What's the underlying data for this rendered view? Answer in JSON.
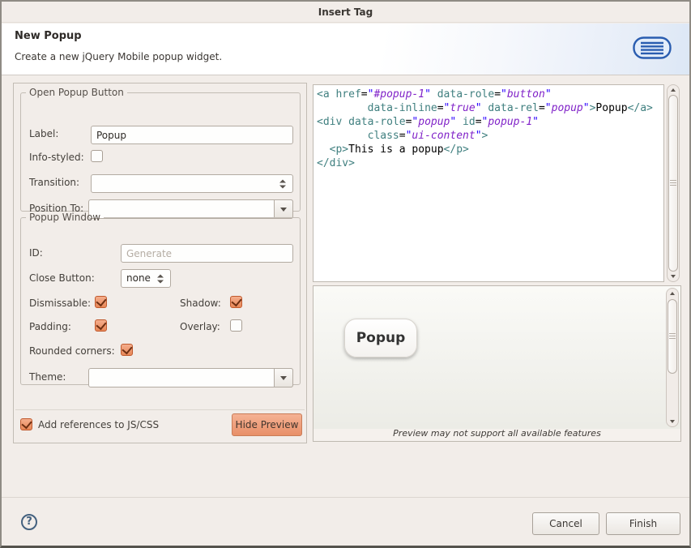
{
  "window": {
    "title": "Insert Tag"
  },
  "header": {
    "title": "New Popup",
    "description": "Create a new jQuery Mobile popup widget."
  },
  "form": {
    "open_popup_button_group": {
      "legend": "Open Popup Button",
      "label_field": {
        "label": "Label:",
        "value": "Popup"
      },
      "info_styled": {
        "label": "Info-styled:",
        "checked": false
      },
      "transition": {
        "label": "Transition:",
        "value": ""
      },
      "position_to": {
        "label": "Position To:",
        "value": ""
      }
    },
    "popup_window_group": {
      "legend": "Popup Window",
      "id_field": {
        "label": "ID:",
        "value": "",
        "placeholder": "Generate"
      },
      "close_button": {
        "label": "Close Button:",
        "value": "none"
      },
      "dismissable": {
        "label": "Dismissable:",
        "checked": true
      },
      "shadow": {
        "label": "Shadow:",
        "checked": true
      },
      "padding": {
        "label": "Padding:",
        "checked": true
      },
      "overlay": {
        "label": "Overlay:",
        "checked": false
      },
      "rounded_corners": {
        "label": "Rounded corners:",
        "checked": true
      },
      "theme": {
        "label": "Theme:",
        "value": ""
      }
    },
    "add_references": {
      "label": "Add references to JS/CSS",
      "checked": true
    },
    "hide_preview_button_label": "Hide Preview"
  },
  "code": {
    "lines": [
      [
        [
          "tag",
          "<a"
        ],
        [
          "pln",
          " "
        ],
        [
          "attr",
          "href"
        ],
        [
          "pln",
          "="
        ],
        [
          "q",
          "\""
        ],
        [
          "val",
          "#popup-1"
        ],
        [
          "q",
          "\""
        ],
        [
          "pln",
          " "
        ],
        [
          "attr",
          "data-role"
        ],
        [
          "pln",
          "="
        ],
        [
          "q",
          "\""
        ],
        [
          "val",
          "button"
        ],
        [
          "q",
          "\""
        ]
      ],
      [
        [
          "pln",
          "        "
        ],
        [
          "attr",
          "data-inline"
        ],
        [
          "pln",
          "="
        ],
        [
          "q",
          "\""
        ],
        [
          "val",
          "true"
        ],
        [
          "q",
          "\""
        ],
        [
          "pln",
          " "
        ],
        [
          "attr",
          "data-rel"
        ],
        [
          "pln",
          "="
        ],
        [
          "q",
          "\""
        ],
        [
          "val",
          "popup"
        ],
        [
          "q",
          "\""
        ],
        [
          "tag",
          ">"
        ],
        [
          "pln",
          "Popup"
        ],
        [
          "tag",
          "</a>"
        ]
      ],
      [
        [
          "tag",
          "<div"
        ],
        [
          "pln",
          " "
        ],
        [
          "attr",
          "data-role"
        ],
        [
          "pln",
          "="
        ],
        [
          "q",
          "\""
        ],
        [
          "val",
          "popup"
        ],
        [
          "q",
          "\""
        ],
        [
          "pln",
          " "
        ],
        [
          "attr",
          "id"
        ],
        [
          "pln",
          "="
        ],
        [
          "q",
          "\""
        ],
        [
          "val",
          "popup-1"
        ],
        [
          "q",
          "\""
        ]
      ],
      [
        [
          "pln",
          "        "
        ],
        [
          "attr",
          "class"
        ],
        [
          "pln",
          "="
        ],
        [
          "q",
          "\""
        ],
        [
          "val",
          "ui-content"
        ],
        [
          "q",
          "\""
        ],
        [
          "tag",
          ">"
        ]
      ],
      [
        [
          "pln",
          "  "
        ],
        [
          "tag",
          "<p>"
        ],
        [
          "pln",
          "This is a popup"
        ],
        [
          "tag",
          "</p>"
        ]
      ],
      [
        [
          "tag",
          "</div>"
        ]
      ]
    ]
  },
  "preview": {
    "button_label": "Popup",
    "caption": "Preview may not support all available features"
  },
  "footer": {
    "help_label": "?",
    "cancel_label": "Cancel",
    "finish_label": "Finish"
  },
  "colors": {
    "dialog_background": "#F2EDE9",
    "checkbox_accent": "#E78757",
    "highlight_button": "#E88F68",
    "header_icon_blue": "#2A5DB0",
    "code_tag": "#3F7F7F",
    "code_quote": "#2A00FF",
    "code_value": "#8022C8"
  }
}
